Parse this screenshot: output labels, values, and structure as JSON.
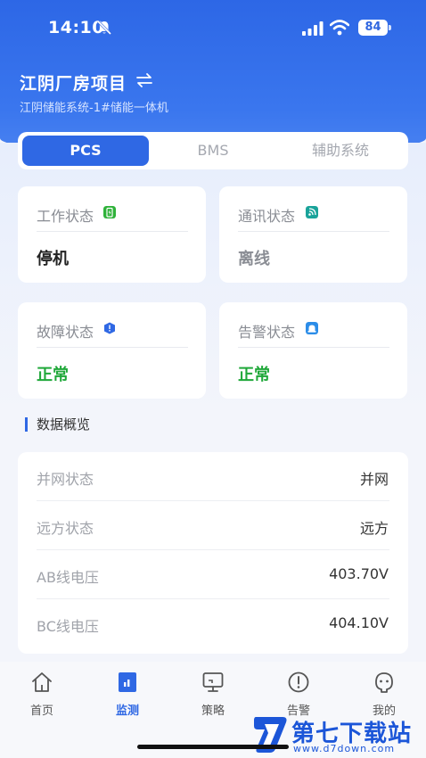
{
  "status_bar": {
    "time": "14:10",
    "battery": "84",
    "icons": [
      "bell-slash-icon",
      "signal-icon",
      "wifi-icon",
      "battery-icon"
    ]
  },
  "header": {
    "title": "江阴厂房项目",
    "subtitle": "江阴储能系统-1#储能一体机",
    "switch_icon": "swap-arrows-icon"
  },
  "tabs": [
    {
      "label": "PCS",
      "active": true
    },
    {
      "label": "BMS",
      "active": false
    },
    {
      "label": "辅助系统",
      "active": false
    }
  ],
  "cards": [
    {
      "label": "工作状态",
      "value": "停机",
      "icon": "battery-charging-icon",
      "badge_color": "#2fb23a",
      "value_color": "#222222"
    },
    {
      "label": "通讯状态",
      "value": "离线",
      "icon": "signal-wave-icon",
      "badge_color": "#1aa39a",
      "value_color": "#8a8d94"
    },
    {
      "label": "故障状态",
      "value": "正常",
      "icon": "shield-alert-icon",
      "badge_color": "#2f68e4",
      "value_color": "#20a83a"
    },
    {
      "label": "告警状态",
      "value": "正常",
      "icon": "alarm-icon",
      "badge_color": "#2c8de8",
      "value_color": "#20a83a"
    }
  ],
  "overview": {
    "title": "数据概览",
    "rows": [
      {
        "label": "并网状态",
        "value": "并网"
      },
      {
        "label": "远方状态",
        "value": "远方"
      },
      {
        "label": "AB线电压",
        "value": "403.70V"
      },
      {
        "label": "BC线电压",
        "value": "404.10V"
      }
    ]
  },
  "nav": [
    {
      "label": "首页",
      "icon": "home-icon",
      "active": false
    },
    {
      "label": "监测",
      "icon": "monitor-chart-icon",
      "active": true
    },
    {
      "label": "策略",
      "icon": "strategy-screen-icon",
      "active": false
    },
    {
      "label": "告警",
      "icon": "alert-circle-icon",
      "active": false
    },
    {
      "label": "我的",
      "icon": "user-face-icon",
      "active": false
    }
  ],
  "watermark": {
    "text": "第七下载站",
    "url": "www.d7down.com"
  },
  "colors": {
    "primary": "#2f68e4",
    "ok": "#20a83a"
  }
}
